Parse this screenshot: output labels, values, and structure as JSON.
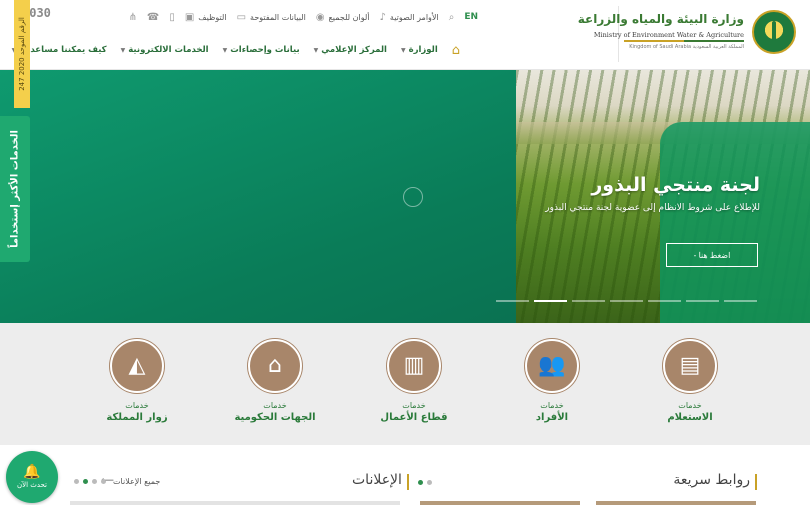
{
  "header": {
    "logo_ar": "وزارة البيئة والمياه والزراعة",
    "logo_en": "Ministry of Environment Water & Agriculture",
    "logo_ks": "المملكة العربية السعودية Kingdom of Saudi Arabia",
    "lang": "EN",
    "vision": "2030",
    "utilities": [
      {
        "label": "الأوامر الصوتية",
        "icon": "microphone-icon"
      },
      {
        "label": "ألوان للجميع",
        "icon": "eye-icon"
      },
      {
        "label": "البيانات المفتوحة",
        "icon": "folder-icon"
      },
      {
        "label": "التوظيف",
        "icon": "briefcase-icon"
      }
    ],
    "nav": [
      {
        "label": "الوزارة"
      },
      {
        "label": "المركز الإعلامي"
      },
      {
        "label": "بيانات وإحصاءات"
      },
      {
        "label": "الخدمات الالكترونية"
      },
      {
        "label": "كيف يمكننا مساعدتك"
      }
    ]
  },
  "side_tabs": {
    "unified": "الرقم الموحد 2020 247",
    "services": "الخدمات الأكثر إستخداماً"
  },
  "hero": {
    "title": "لجنة منتجي البذور",
    "subtitle": "للإطلاع على شروط الانظام إلى عضوية لجنة منتجي البذور",
    "button": "اضغط هنا",
    "slides": 7,
    "active_slide": 2
  },
  "services": [
    {
      "small": "خدمات",
      "big": "الاستعلام",
      "icon": "passport-icon"
    },
    {
      "small": "خدمات",
      "big": "الأفراد",
      "icon": "people-icon"
    },
    {
      "small": "خدمات",
      "big": "قطاع الأعمال",
      "icon": "building-icon"
    },
    {
      "small": "خدمات",
      "big": "الجهات الحكومية",
      "icon": "government-icon"
    },
    {
      "small": "خدمات",
      "big": "زوار المملكة",
      "icon": "saudi-map-icon"
    }
  ],
  "bottom": {
    "quick_links": "روابط سريعة",
    "announcements": "الإعلانات",
    "all_announcements": "جميع الإعلانات"
  },
  "chat": {
    "label": "تحدث الآن"
  }
}
